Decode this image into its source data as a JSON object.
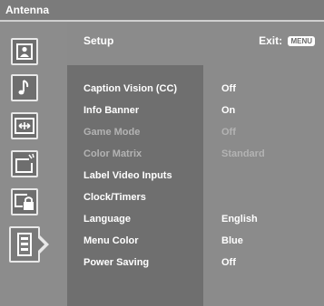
{
  "topbar": {
    "title": "Antenna"
  },
  "header": {
    "section": "Setup",
    "exit_label": "Exit:",
    "exit_key": "MENU"
  },
  "sidebar": {
    "icons": [
      {
        "name": "picture-icon"
      },
      {
        "name": "sound-icon"
      },
      {
        "name": "screen-icon"
      },
      {
        "name": "channel-icon"
      },
      {
        "name": "parental-lock-icon"
      },
      {
        "name": "setup-icon",
        "active": true
      }
    ]
  },
  "menu": {
    "items": [
      {
        "label": "Caption Vision (CC)",
        "value": "Off",
        "enabled": true
      },
      {
        "label": "Info Banner",
        "value": "On",
        "enabled": true
      },
      {
        "label": "Game Mode",
        "value": "Off",
        "enabled": false
      },
      {
        "label": "Color Matrix",
        "value": "Standard",
        "enabled": false
      },
      {
        "label": "Label Video Inputs",
        "value": "",
        "enabled": true
      },
      {
        "label": "Clock/Timers",
        "value": "",
        "enabled": true
      },
      {
        "label": "Language",
        "value": "English",
        "enabled": true
      },
      {
        "label": "Menu Color",
        "value": "Blue",
        "enabled": true
      },
      {
        "label": "Power Saving",
        "value": "Off",
        "enabled": true
      }
    ]
  }
}
